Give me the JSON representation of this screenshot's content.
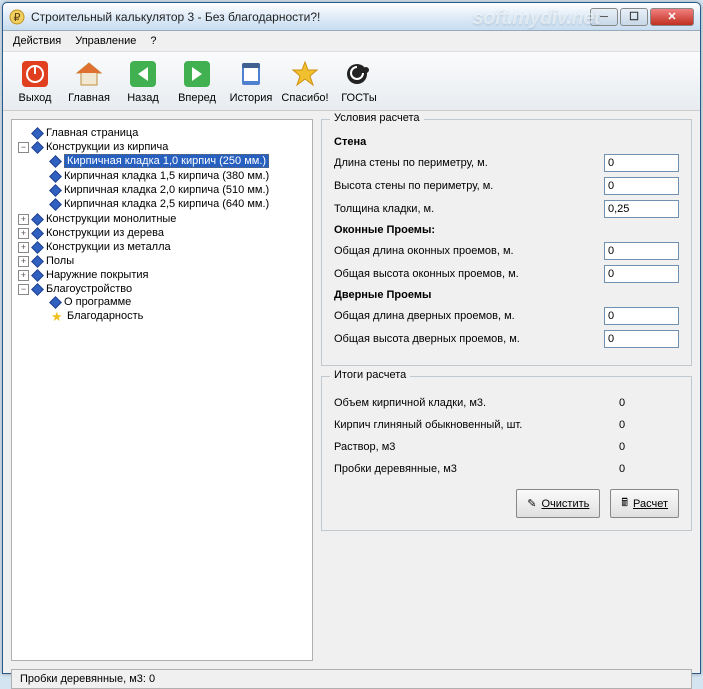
{
  "title": "Строительный калькулятор 3 - Без благодарности?!",
  "watermark": "soft.mydiv.net",
  "menu": {
    "actions": "Действия",
    "manage": "Управление",
    "help": "?"
  },
  "toolbar": {
    "exit": "Выход",
    "home": "Главная",
    "back": "Назад",
    "forward": "Вперед",
    "history": "История",
    "thanks": "Спасибо!",
    "gosty": "ГОСТы"
  },
  "tree": {
    "main": "Главная страница",
    "brick": "Конструкции из кирпича",
    "brick_items": [
      "Кирпичная кладка 1,0 кирпич (250 мм.)",
      "Кирпичная кладка 1,5 кирпича (380 мм.)",
      "Кирпичная кладка 2,0 кирпича  (510 мм.)",
      "Кирпичная кладка 2,5 кирпича  (640 мм.)"
    ],
    "mono": "Конструкции монолитные",
    "wood": "Конструкции из дерева",
    "metal": "Конструкции из металла",
    "floors": "Полы",
    "ext": "Наружние покрытия",
    "landscape": "Благоустройство",
    "about": "О программе",
    "thanks": "Благодарность"
  },
  "calc": {
    "conditions_title": "Условия расчета",
    "wall": "Стена",
    "wall_len": "Длина стены по периметру, м.",
    "wall_h": "Высота стены по периметру, м.",
    "thickness": "Толщина кладки, м.",
    "thickness_val": "0,25",
    "windows": "Оконные Проемы:",
    "win_len": "Общая длина оконных проемов, м.",
    "win_h": "Общая высота оконных проемов, м.",
    "doors": "Дверные Проемы",
    "door_len": "Общая длина дверных проемов, м.",
    "door_h": "Общая высота дверных проемов, м.",
    "val0": "0",
    "results_title": "Итоги расчета",
    "r1": "Объем кирпичной кладки, м3.",
    "r2": "Кирпич глиняный обыкновенный, шт.",
    "r3": "Раствор, м3",
    "r4": "Пробки деревянные, м3",
    "rv": "0",
    "clear": "Очистить",
    "calc": "Расчет"
  },
  "status": "Пробки деревянные, м3: 0"
}
